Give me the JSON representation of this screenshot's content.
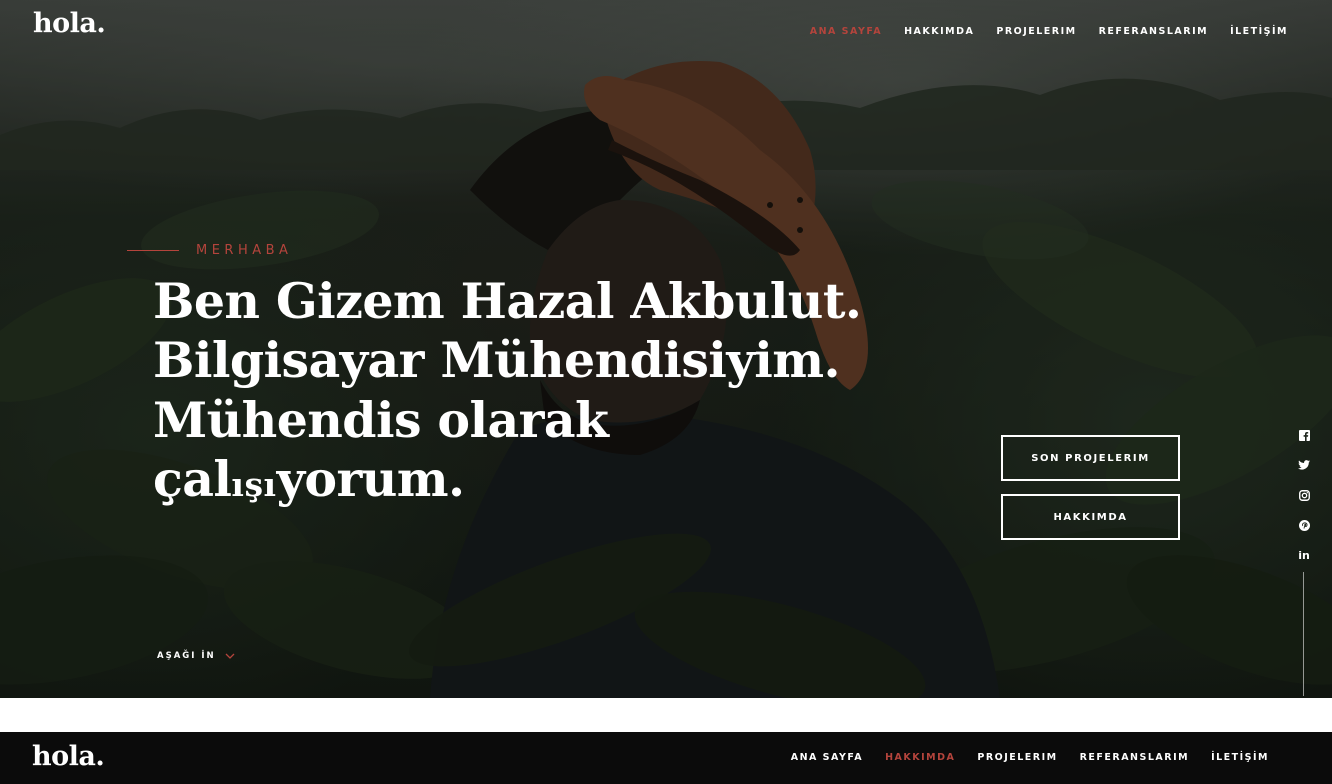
{
  "brand": {
    "logo": "hola."
  },
  "nav": {
    "items": [
      "ANA SAYFA",
      "HAKKIMDA",
      "PROJELERIM",
      "REFERANSLARIM",
      "İLETİŞİM"
    ]
  },
  "hero": {
    "intro": "MERHABA",
    "headline": {
      "line1": "Ben Gizem Hazal Akbulut.",
      "line2": "Bilgisayar Mühendisiyim.",
      "line3": "Mühendis olarak",
      "line4_a": "çal",
      "line4_b": "ışı",
      "line4_c": "yorum."
    },
    "cta_primary": "SON PROJELERIM",
    "cta_secondary": "HAKKIMDA",
    "scroll_label": "AŞAĞI İN"
  },
  "social": {
    "items": [
      "facebook-icon",
      "twitter-icon",
      "instagram-icon",
      "pinterest-icon",
      "linkedin-icon"
    ],
    "linkedin_text": "in"
  },
  "colors": {
    "accent": "#b4443c",
    "bar_bg": "#0b0b0b",
    "text": "#ffffff"
  },
  "bottom_bar": {
    "logo": "hola.",
    "active_item": "HAKKIMDA"
  }
}
